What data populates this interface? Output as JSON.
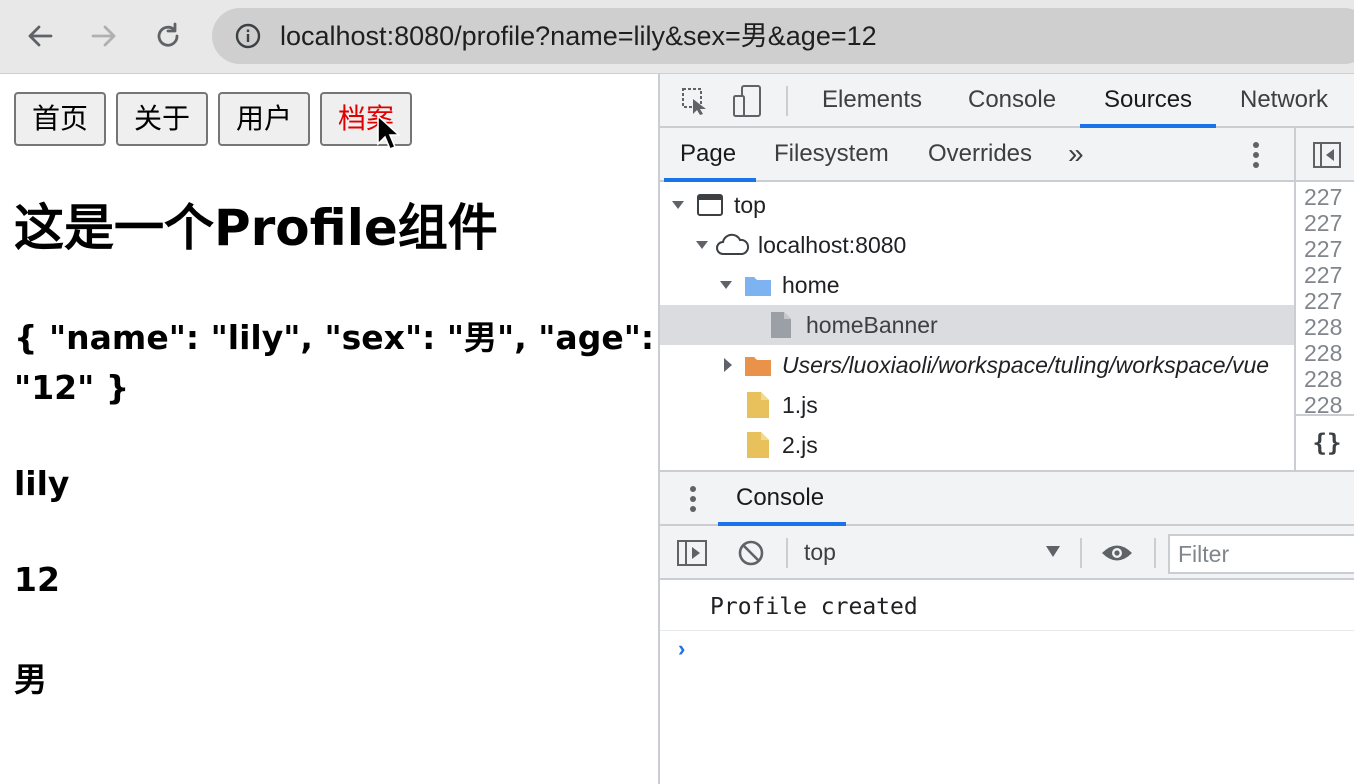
{
  "browser": {
    "url": "localhost:8080/profile?name=lily&sex=男&age=12"
  },
  "page": {
    "nav_links": [
      {
        "label": "首页"
      },
      {
        "label": "关于"
      },
      {
        "label": "用户"
      },
      {
        "label": "档案",
        "active": true
      }
    ],
    "title": "这是一个Profile组件",
    "json_line1": "{ \"name\": \"lily\", \"sex\": \"男\", \"age\":",
    "json_line2": "\"12\" }",
    "name_value": "lily",
    "age_value": "12",
    "sex_value": "男"
  },
  "devtools": {
    "tabs": [
      "Elements",
      "Console",
      "Sources",
      "Network"
    ],
    "active_tab": "Sources",
    "more_tabs_glyph": "»",
    "navigator_tabs": [
      "Page",
      "Filesystem",
      "Overrides"
    ],
    "active_navigator_tab": "Page",
    "tree": {
      "top": "top",
      "origin": "localhost:8080",
      "folder_home": "home",
      "file_homeBanner": "homeBanner",
      "folder_users": "Users/luoxiaoli/workspace/tuling/workspace/vue",
      "file_1": "1.js",
      "file_2": "2.js"
    },
    "line_numbers": [
      "227",
      "227",
      "227",
      "227",
      "227",
      "228",
      "228",
      "228",
      "228"
    ],
    "pretty_print": "{}",
    "drawer": {
      "tab": "Console",
      "context": "top",
      "filter_placeholder": "Filter",
      "log": "Profile created",
      "prompt": "›"
    }
  },
  "colors": {
    "active_link": "#e00000",
    "accent": "#1a73e8",
    "folder_blue": "#7cb3f0",
    "folder_orange": "#e8924a",
    "js_file": "#e9c15c"
  }
}
